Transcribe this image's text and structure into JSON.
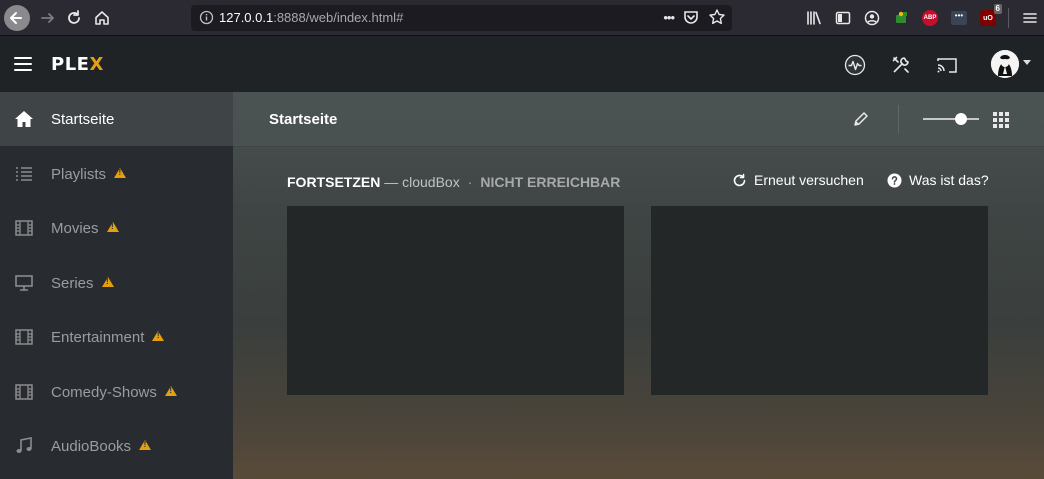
{
  "browser": {
    "url_host": "127.0.0.1",
    "url_rest": ":8888/web/index.html#",
    "page_actions_label": "•••",
    "abp_label": "ABP",
    "ublock_label": "uO",
    "ublock_badge": "6",
    "ext_dots_label": "•••"
  },
  "header": {
    "logo_main": "PLE",
    "logo_x": "X"
  },
  "sidebar": {
    "items": [
      {
        "label": "Startseite",
        "icon": "home-icon",
        "active": true,
        "warning": false
      },
      {
        "label": "Playlists",
        "icon": "list-icon",
        "active": false,
        "warning": true
      },
      {
        "label": "Movies",
        "icon": "film-icon",
        "active": false,
        "warning": true
      },
      {
        "label": "Series",
        "icon": "monitor-icon",
        "active": false,
        "warning": true
      },
      {
        "label": "Entertainment",
        "icon": "film-icon",
        "active": false,
        "warning": true
      },
      {
        "label": "Comedy-Shows",
        "icon": "film-icon",
        "active": false,
        "warning": true
      },
      {
        "label": "AudioBooks",
        "icon": "music-note-icon",
        "active": false,
        "warning": true
      }
    ]
  },
  "main": {
    "title": "Startseite",
    "section": {
      "title": "FORTSETZEN",
      "server": "— cloudBox",
      "separator": "·",
      "status": "NICHT ERREICHBAR"
    },
    "retry_label": "Erneut versuchen",
    "whatis_label": "Was ist das?"
  },
  "colors": {
    "accent": "#e5a00d",
    "background": "#1f2326",
    "sidebar": "#282c30"
  }
}
